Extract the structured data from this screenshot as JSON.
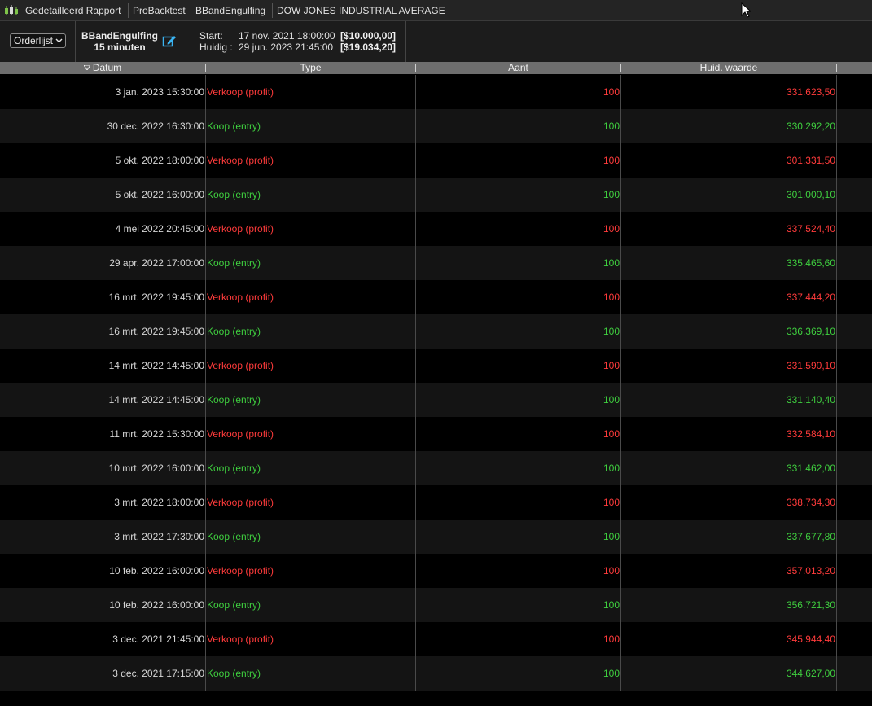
{
  "titlebar": {
    "crumbs": [
      "Gedetailleerd Rapport",
      "ProBacktest",
      "BBandEngulfing",
      "DOW JONES INDUSTRIAL AVERAGE"
    ]
  },
  "toolbar": {
    "view_select": "Orderlijst",
    "strategy_name": "BBandEngulfing",
    "timeframe": "15 minuten",
    "start_label": "Start:",
    "start_date": "17 nov. 2021 18:00:00",
    "start_amount": "[$10.000,00]",
    "current_label": "Huidig :",
    "current_date": "29 jun. 2023 21:45:00",
    "current_amount": "[$19.034,20]"
  },
  "table": {
    "columns": [
      "Datum",
      "Type",
      "Aant",
      "Huid. waarde"
    ],
    "rows": [
      {
        "date": "3 jan. 2023 15:30:00",
        "type": "Verkoop (profit)",
        "qty": "100",
        "value": "331.623,50",
        "color": "red"
      },
      {
        "date": "30 dec. 2022 16:30:00",
        "type": "Koop (entry)",
        "qty": "100",
        "value": "330.292,20",
        "color": "green"
      },
      {
        "date": "5 okt. 2022 18:00:00",
        "type": "Verkoop (profit)",
        "qty": "100",
        "value": "301.331,50",
        "color": "red"
      },
      {
        "date": "5 okt. 2022 16:00:00",
        "type": "Koop (entry)",
        "qty": "100",
        "value": "301.000,10",
        "color": "green"
      },
      {
        "date": "4 mei 2022 20:45:00",
        "type": "Verkoop (profit)",
        "qty": "100",
        "value": "337.524,40",
        "color": "red"
      },
      {
        "date": "29 apr. 2022 17:00:00",
        "type": "Koop (entry)",
        "qty": "100",
        "value": "335.465,60",
        "color": "green"
      },
      {
        "date": "16 mrt. 2022 19:45:00",
        "type": "Verkoop (profit)",
        "qty": "100",
        "value": "337.444,20",
        "color": "red"
      },
      {
        "date": "16 mrt. 2022 19:45:00",
        "type": "Koop (entry)",
        "qty": "100",
        "value": "336.369,10",
        "color": "green"
      },
      {
        "date": "14 mrt. 2022 14:45:00",
        "type": "Verkoop (profit)",
        "qty": "100",
        "value": "331.590,10",
        "color": "red"
      },
      {
        "date": "14 mrt. 2022 14:45:00",
        "type": "Koop (entry)",
        "qty": "100",
        "value": "331.140,40",
        "color": "green"
      },
      {
        "date": "11 mrt. 2022 15:30:00",
        "type": "Verkoop (profit)",
        "qty": "100",
        "value": "332.584,10",
        "color": "red"
      },
      {
        "date": "10 mrt. 2022 16:00:00",
        "type": "Koop (entry)",
        "qty": "100",
        "value": "331.462,00",
        "color": "green"
      },
      {
        "date": "3 mrt. 2022 18:00:00",
        "type": "Verkoop (profit)",
        "qty": "100",
        "value": "338.734,30",
        "color": "red"
      },
      {
        "date": "3 mrt. 2022 17:30:00",
        "type": "Koop (entry)",
        "qty": "100",
        "value": "337.677,80",
        "color": "green"
      },
      {
        "date": "10 feb. 2022 16:00:00",
        "type": "Verkoop (profit)",
        "qty": "100",
        "value": "357.013,20",
        "color": "red"
      },
      {
        "date": "10 feb. 2022 16:00:00",
        "type": "Koop (entry)",
        "qty": "100",
        "value": "356.721,30",
        "color": "green"
      },
      {
        "date": "3 dec. 2021 21:45:00",
        "type": "Verkoop (profit)",
        "qty": "100",
        "value": "345.944,40",
        "color": "red"
      },
      {
        "date": "3 dec. 2021 17:15:00",
        "type": "Koop (entry)",
        "qty": "100",
        "value": "344.627,00",
        "color": "green"
      }
    ]
  }
}
